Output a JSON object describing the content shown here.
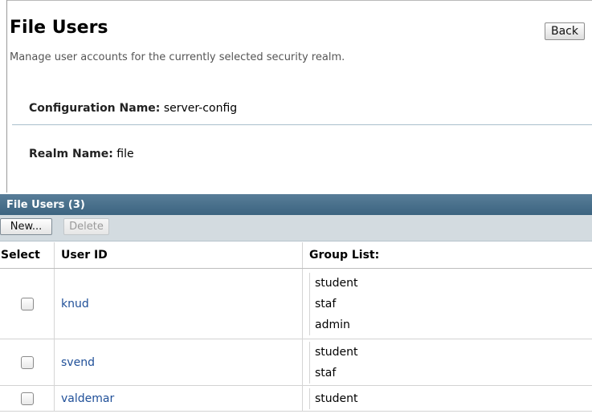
{
  "page": {
    "title": "File Users",
    "description": "Manage user accounts for the currently selected security realm.",
    "back_label": "Back"
  },
  "fields": {
    "configuration_label": "Configuration Name:",
    "configuration_value": "server-config",
    "realm_label": "Realm Name:",
    "realm_value": "file"
  },
  "table": {
    "title": "File Users (3)",
    "toolbar": {
      "new_label": "New...",
      "delete_label": "Delete"
    },
    "columns": {
      "select": "Select",
      "user_id": "User ID",
      "group_list": "Group List:"
    },
    "rows": [
      {
        "user_id": "knud",
        "groups": [
          "student",
          "staf",
          "admin"
        ]
      },
      {
        "user_id": "svend",
        "groups": [
          "student",
          "staf"
        ]
      },
      {
        "user_id": "valdemar",
        "groups": [
          "student"
        ]
      }
    ]
  }
}
